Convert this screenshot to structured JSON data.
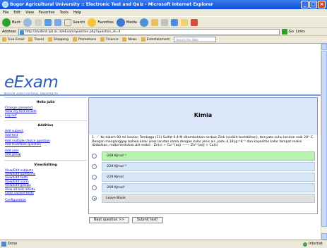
{
  "window": {
    "title": "Bogor Agricultural University :: Electronic Test and Quiz - Microsoft Internet Explorer",
    "minimize": "_",
    "maximize": "□",
    "close": "×"
  },
  "menu": [
    "File",
    "Edit",
    "View",
    "Favorites",
    "Tools",
    "Help"
  ],
  "toolbar": {
    "back": "Back",
    "search": "Search",
    "favorites": "Favorites",
    "media": "Media"
  },
  "address": {
    "label": "Address",
    "url": "http://student.ipb.ac.id/eExam/question.php?question_id=4",
    "go": "Go",
    "links": "Links"
  },
  "links_bar": {
    "items": [
      "Free Email",
      "Travel",
      "Shopping",
      "Promotions",
      "Finance",
      "News",
      "Entertainment"
    ],
    "search_box": "Search the Web"
  },
  "logo": {
    "brand": "eExam",
    "subtitle": "BOGOR AGRICULTURAL UNIVERSITY"
  },
  "sidebar": {
    "greeting": "Hello julia",
    "account_links": [
      "Change password",
      "View my test results",
      "Log out"
    ],
    "addition_title": "Addition",
    "addition_links": [
      "Add subject",
      "Add test",
      "Add multiple choice question",
      "Add true/false question",
      "Add user",
      "Add group"
    ],
    "view_title": "View/Editing",
    "view_links": [
      "View/Edit subjects",
      "View/Edit questions",
      "View/Edit tests",
      "View/Edit users",
      "View/Edit groups",
      "View all test results",
      "Clear cached tests"
    ],
    "config_link": "Configuration"
  },
  "main": {
    "subject": "Kimia",
    "question_number": "1.",
    "question_text": "Ke dalam 90 ml larutan Tembaga (11) Sulfat 0,4 M ditambahkan serbuk Zink (sedikit berlebihan), ternyata suhu larutan naik 20° C. Dengan menganggap bahwa kalor jenis larutan sama dengan kalor jenis air, yaitu 4,18 Jg⁻¹K⁻¹ dan kapasitas kalor tempat reaksi diabaikan, maka tentukan ∆H reaksi : Zn(s) + Cu²⁺(aq) ——› Zn²⁺(aq) + Cu(s)",
    "options": [
      {
        "label": "-209 KJmol⁻¹",
        "highlight": "green",
        "selected": false
      },
      {
        "label": "-229 KJmol⁻¹",
        "highlight": "blue",
        "selected": false
      },
      {
        "label": "-229 KJmol",
        "highlight": "blue",
        "selected": false
      },
      {
        "label": "-209 KJmol⁰",
        "highlight": "blue",
        "selected": false
      },
      {
        "label": "Leave Blank",
        "highlight": "grey",
        "selected": true
      }
    ],
    "next_button": "Next question >>",
    "submit_button": "Submit test!"
  },
  "status": {
    "text": "Done",
    "zone": "Internet"
  },
  "colors": {
    "brand": "#2b5eb8",
    "subject_bar": "#dbe7f8",
    "correct_option": "#b9f3b0",
    "option": "#d6e7f7"
  }
}
